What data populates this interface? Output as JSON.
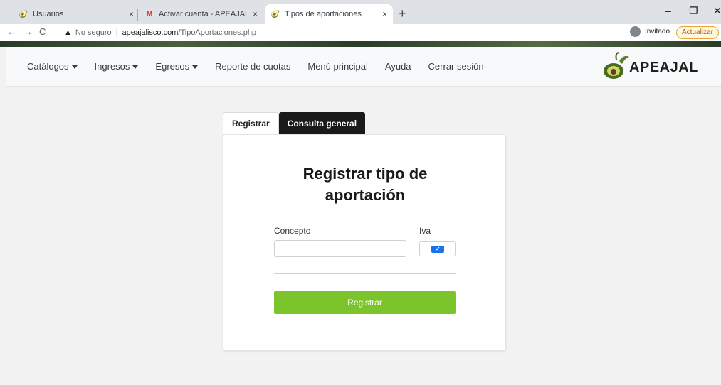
{
  "browser": {
    "tabs": [
      {
        "title": "Usuarios",
        "icon": "apeajal-favicon"
      },
      {
        "title": "Activar cuenta - APEAJAL - annet",
        "icon": "gmail-icon"
      },
      {
        "title": "Tipos de aportaciones",
        "icon": "apeajal-favicon",
        "active": true
      }
    ],
    "close_glyph": "×",
    "new_tab_glyph": "+",
    "security_label": "No seguro",
    "url_host": "apeajalisco.com",
    "url_path": "/TipoAportaciones.php",
    "profile_label": "Invitado",
    "update_label": "Actualizar"
  },
  "navbar": {
    "items": [
      {
        "label": "Catálogos",
        "dropdown": true
      },
      {
        "label": "Ingresos",
        "dropdown": true
      },
      {
        "label": "Egresos",
        "dropdown": true
      },
      {
        "label": "Reporte de cuotas",
        "dropdown": false
      },
      {
        "label": "Menú principal",
        "dropdown": false
      },
      {
        "label": "Ayuda",
        "dropdown": false
      },
      {
        "label": "Cerrar sesión",
        "dropdown": false
      }
    ],
    "logo_text": "APEAJAL"
  },
  "form_tabs": {
    "register": "Registrar",
    "consult": "Consulta general"
  },
  "form": {
    "title_line1": "Registrar tipo de",
    "title_line2": "aportación",
    "concept_label": "Concepto",
    "concept_value": "",
    "iva_label": "Iva",
    "iva_checked": true,
    "submit_label": "Registrar"
  },
  "colors": {
    "submit": "#7cc42b",
    "checkbox": "#1a73e8",
    "dark_tab": "#1a1a1a"
  }
}
